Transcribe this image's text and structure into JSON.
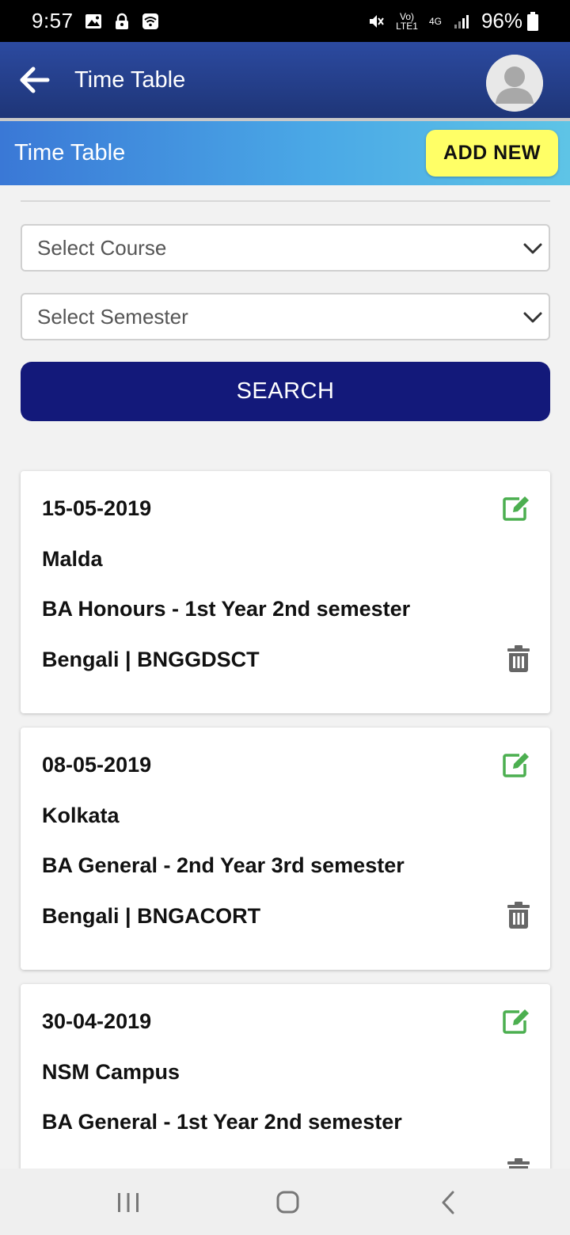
{
  "status_bar": {
    "time": "9:57",
    "network_top": "Vo)",
    "network_bottom": "LTE1",
    "network_type": "4G",
    "battery": "96%",
    "icons": [
      "gallery-icon",
      "lock-icon",
      "wifi-icon",
      "mute-icon",
      "signal-icon",
      "battery-icon"
    ]
  },
  "app_bar": {
    "title": "Time Table",
    "back_icon": "arrow-left-icon",
    "avatar_icon": "user-avatar-icon"
  },
  "section": {
    "title": "Time Table",
    "add_new_label": "ADD NEW"
  },
  "filters": {
    "course_placeholder": "Select Course",
    "semester_placeholder": "Select Semester",
    "search_label": "SEARCH"
  },
  "cards": [
    {
      "date": "15-05-2019",
      "location": "Malda",
      "course": "BA Honours - 1st Year 2nd semester",
      "subject": "Bengali | BNGGDSCT"
    },
    {
      "date": "08-05-2019",
      "location": "Kolkata",
      "course": "BA General - 2nd Year 3rd semester",
      "subject": "Bengali | BNGACORT"
    },
    {
      "date": "30-04-2019",
      "location": "NSM Campus",
      "course": "BA General - 1st Year 2nd semester",
      "subject": ""
    }
  ],
  "colors": {
    "app_bar": "#1e3577",
    "add_new": "#ffff66",
    "search_button": "#13197a",
    "edit_icon": "#4caf50",
    "delete_icon": "#666666"
  },
  "nav_bar": {
    "buttons": [
      "recent-apps-icon",
      "home-icon",
      "back-icon"
    ]
  }
}
